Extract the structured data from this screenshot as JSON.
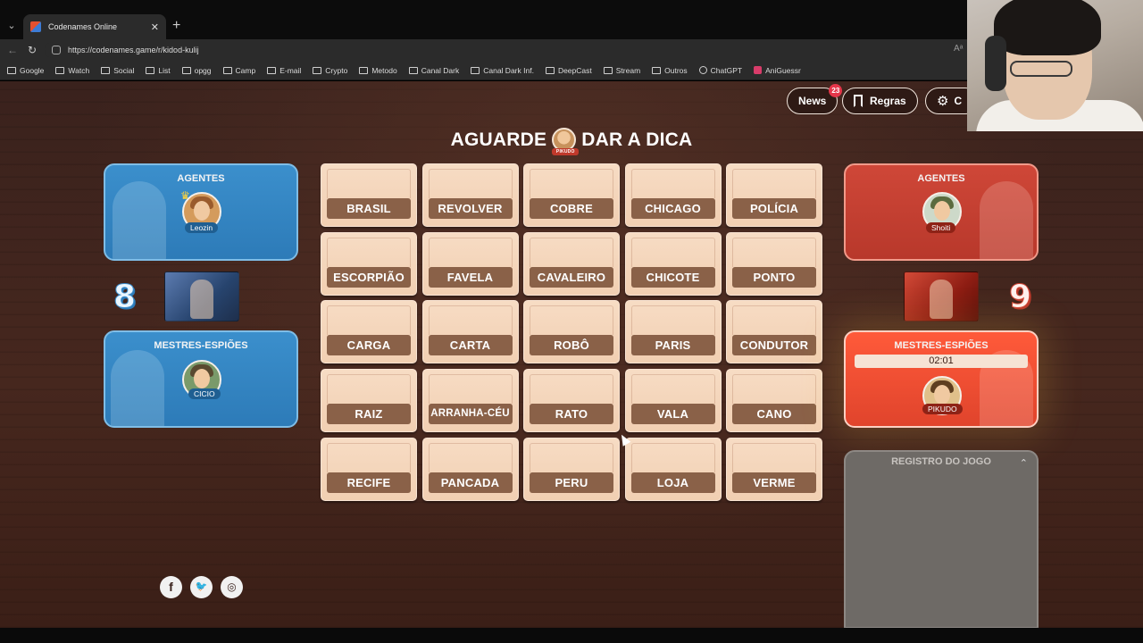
{
  "browser": {
    "tab_title": "Codenames Online",
    "url": "https://codenames.game/r/kidod-kulij",
    "bookmarks": [
      {
        "label": "Google",
        "icon": "folder-icon"
      },
      {
        "label": "Watch",
        "icon": "folder-icon"
      },
      {
        "label": "Social",
        "icon": "folder-icon"
      },
      {
        "label": "List",
        "icon": "folder-icon"
      },
      {
        "label": "opgg",
        "icon": "folder-icon"
      },
      {
        "label": "Camp",
        "icon": "folder-icon"
      },
      {
        "label": "E-mail",
        "icon": "folder-icon"
      },
      {
        "label": "Crypto",
        "icon": "folder-icon"
      },
      {
        "label": "Metodo",
        "icon": "folder-icon"
      },
      {
        "label": "Canal Dark",
        "icon": "folder-icon"
      },
      {
        "label": "Canal Dark Inf.",
        "icon": "folder-icon"
      },
      {
        "label": "DeepCast",
        "icon": "folder-icon"
      },
      {
        "label": "Stream",
        "icon": "folder-icon"
      },
      {
        "label": "Outros",
        "icon": "folder-icon"
      },
      {
        "label": "ChatGPT",
        "icon": "globe-icon"
      },
      {
        "label": "AniGuessr",
        "icon": "app-icon"
      }
    ]
  },
  "header": {
    "news_label": "News",
    "news_badge": "23",
    "rules_label": "Regras",
    "settings_label": "C"
  },
  "status": {
    "before": "AGUARDE",
    "avatar_tag": "PIKUDO",
    "after": "DAR A DICA"
  },
  "blue_team": {
    "score": "8",
    "agents_title": "AGENTES",
    "agent_name": "Leozin",
    "spymasters_title": "MESTRES-ESPIÕES",
    "spymaster_name": "CICIO"
  },
  "red_team": {
    "score": "9",
    "agents_title": "AGENTES",
    "agent_name": "Shoiti",
    "spymasters_title": "MESTRES-ESPIÕES",
    "timer": "02:01",
    "spymaster_name": "PIKUDO"
  },
  "log": {
    "title": "REGISTRO DO JOGO"
  },
  "cards": [
    "BRASIL",
    "REVOLVER",
    "COBRE",
    "CHICAGO",
    "POLÍCIA",
    "ESCORPIÃO",
    "FAVELA",
    "CAVALEIRO",
    "CHICOTE",
    "PONTO",
    "CARGA",
    "CARTA",
    "ROBÔ",
    "PARIS",
    "CONDUTOR",
    "RAIZ",
    "ARRANHA-CÉU",
    "RATO",
    "VALA",
    "CANO",
    "RECIFE",
    "PANCADA",
    "PERU",
    "LOJA",
    "VERME"
  ],
  "socials": [
    "facebook-icon",
    "twitter-icon",
    "instagram-icon"
  ],
  "colors": {
    "blue": "#3b8fcc",
    "red": "#cf4738",
    "card": "#f1cfb2",
    "card_label": "#8a6148"
  }
}
